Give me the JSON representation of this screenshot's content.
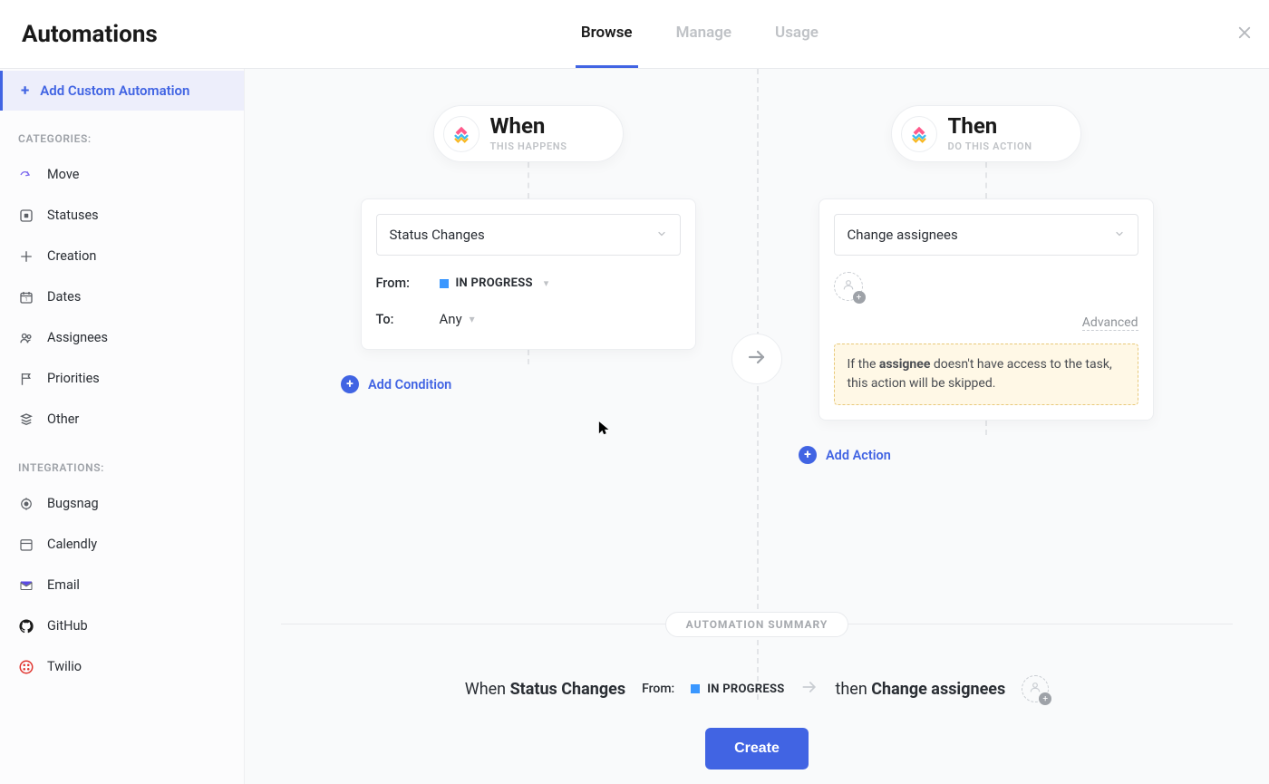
{
  "header": {
    "title": "Automations",
    "tabs": [
      {
        "label": "Browse",
        "active": true
      },
      {
        "label": "Manage",
        "active": false
      },
      {
        "label": "Usage",
        "active": false
      }
    ]
  },
  "sidebar": {
    "add_label": "Add Custom Automation",
    "categories_label": "CATEGORIES:",
    "integrations_label": "INTEGRATIONS:",
    "categories": [
      {
        "label": "Move",
        "icon": "share-arrow"
      },
      {
        "label": "Statuses",
        "icon": "square-dot"
      },
      {
        "label": "Creation",
        "icon": "plus-cross"
      },
      {
        "label": "Dates",
        "icon": "calendar"
      },
      {
        "label": "Assignees",
        "icon": "people"
      },
      {
        "label": "Priorities",
        "icon": "flag"
      },
      {
        "label": "Other",
        "icon": "layers"
      }
    ],
    "integrations": [
      {
        "label": "Bugsnag",
        "icon": "bugsnag"
      },
      {
        "label": "Calendly",
        "icon": "calendly"
      },
      {
        "label": "Email",
        "icon": "email"
      },
      {
        "label": "GitHub",
        "icon": "github"
      },
      {
        "label": "Twilio",
        "icon": "twilio"
      }
    ]
  },
  "when": {
    "title": "When",
    "subtitle": "THIS HAPPENS",
    "trigger_select": "Status Changes",
    "from_label": "From:",
    "from_value": "IN PROGRESS",
    "from_color": "#3a97ff",
    "to_label": "To:",
    "to_value": "Any",
    "add_condition": "Add Condition"
  },
  "then": {
    "title": "Then",
    "subtitle": "DO THIS ACTION",
    "action_select": "Change assignees",
    "advanced_label": "Advanced",
    "warning_pre": "If the ",
    "warning_bold": "assignee",
    "warning_post": " doesn't have access to the task, this action will be skipped.",
    "add_action": "Add Action"
  },
  "summary": {
    "label": "AUTOMATION SUMMARY",
    "when_prefix": "When ",
    "when_trigger": "Status Changes",
    "from_label": "From:",
    "from_value": "IN PROGRESS",
    "then_prefix": "then ",
    "then_action": "Change assignees",
    "create_button": "Create"
  }
}
